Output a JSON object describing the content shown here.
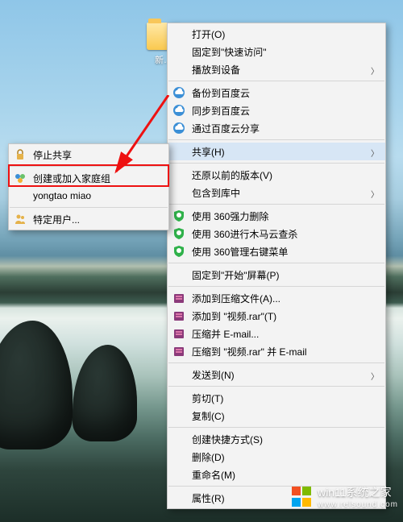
{
  "folder": {
    "name": "新…"
  },
  "mainMenu": {
    "open": "打开(O)",
    "pinQuick": "固定到\"快速访问\"",
    "playTo": "播放到设备",
    "baiduBackup": "备份到百度云",
    "baiduSync": "同步到百度云",
    "baiduShare": "通过百度云分享",
    "share": "共享(H)",
    "restorePrev": "还原以前的版本(V)",
    "includeInLib": "包含到库中",
    "q360Force": "使用 360强力删除",
    "q360Trojan": "使用 360进行木马云查杀",
    "q360Menu": "使用 360管理右键菜单",
    "pinStart": "固定到\"开始\"屏幕(P)",
    "addToArchive": "添加到压缩文件(A)...",
    "addToRar": "添加到 \"视频.rar\"(T)",
    "compressEmail": "压缩并 E-mail...",
    "compressRarEmail": "压缩到 \"视频.rar\" 并 E-mail",
    "sendTo": "发送到(N)",
    "cut": "剪切(T)",
    "copy": "复制(C)",
    "createShortcut": "创建快捷方式(S)",
    "delete": "删除(D)",
    "rename": "重命名(M)",
    "properties": "属性(R)"
  },
  "subMenu": {
    "stopSharing": "停止共享",
    "homegroup": "创建或加入家庭组",
    "user": "yongtao miao",
    "specificUsers": "特定用户..."
  },
  "watermark": {
    "line1": "win11系统之家",
    "line2": "www.relsound.com"
  },
  "colors": {
    "highlight": "#e11",
    "menuHover": "#d7e6f5"
  }
}
